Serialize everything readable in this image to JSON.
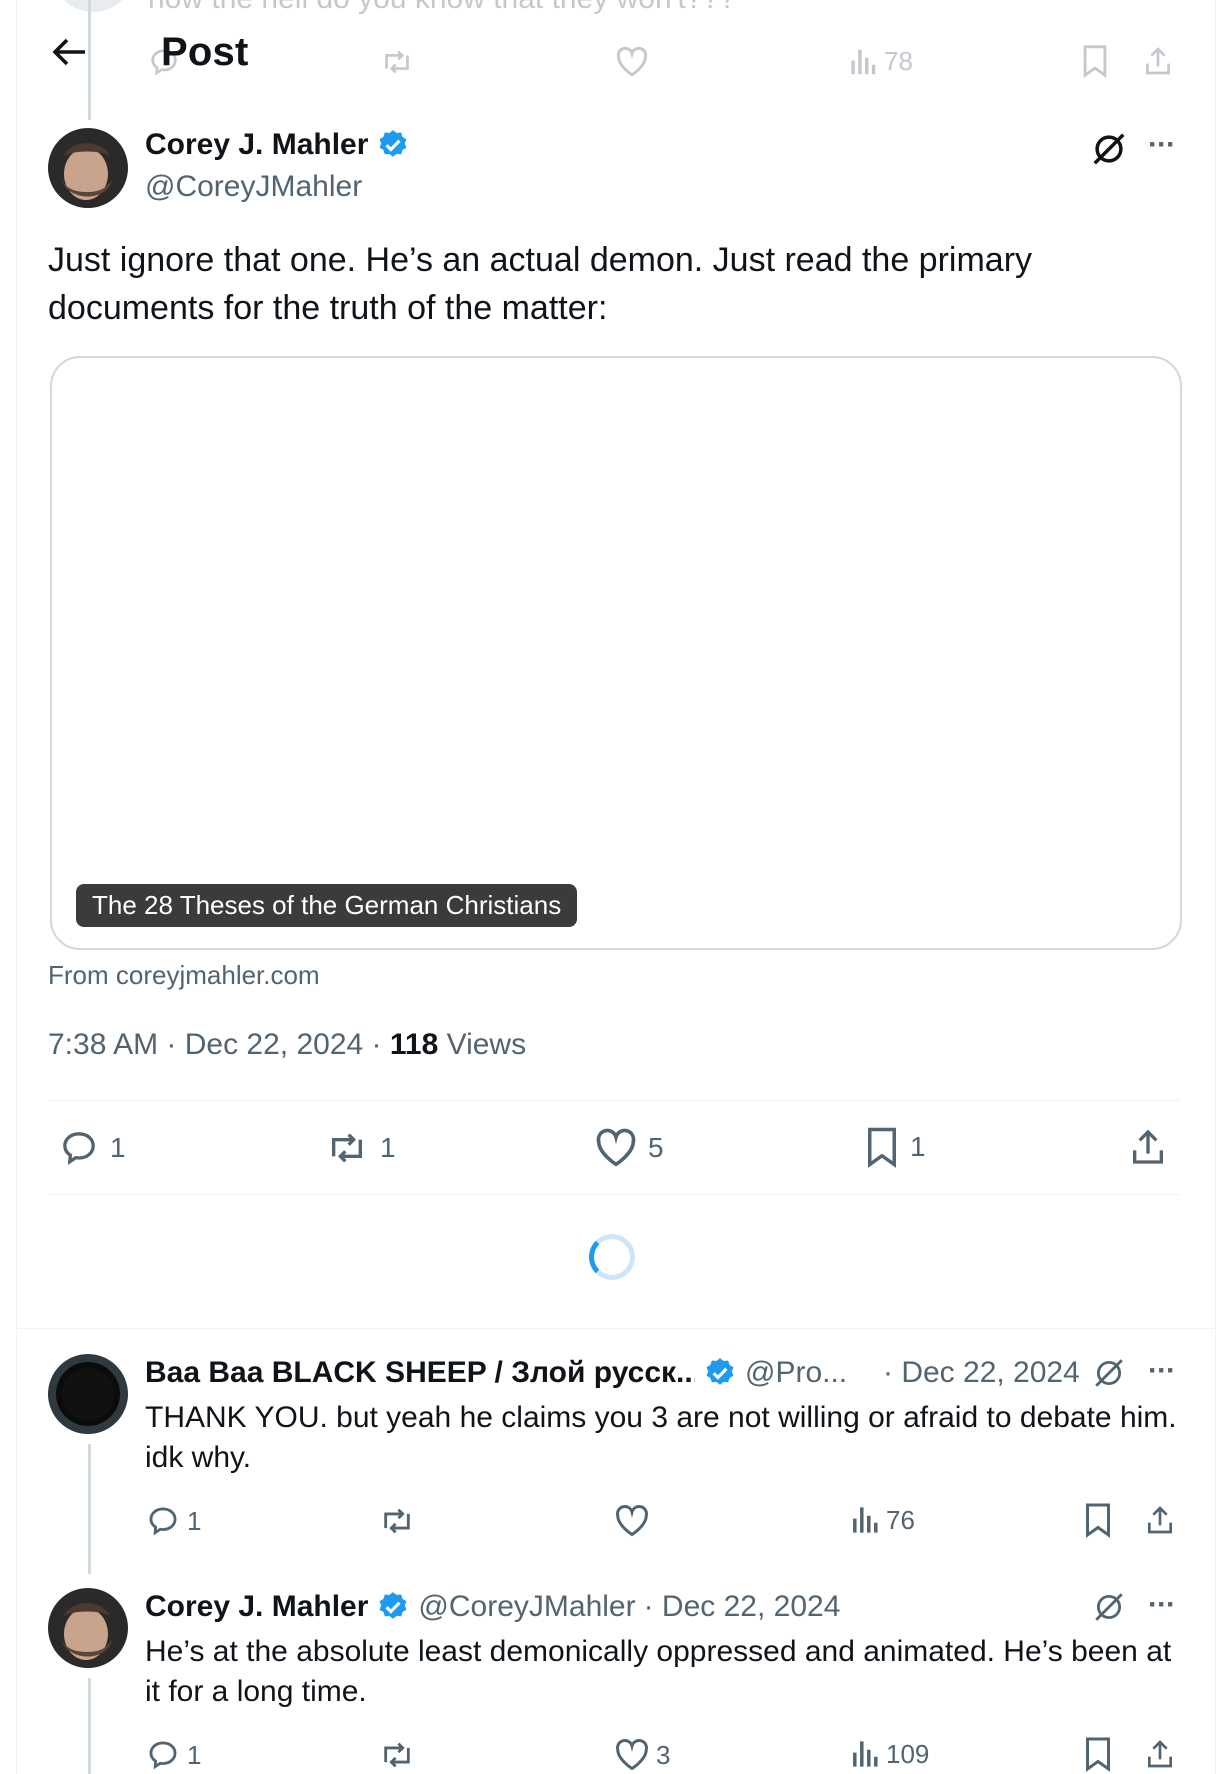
{
  "header": {
    "title": "Post",
    "ghost_text": "how the hell do you know that they won't???",
    "ghost_views": "78"
  },
  "main_post": {
    "author_name": "Corey J. Mahler",
    "author_handle": "@CoreyJMahler",
    "text": "Just ignore that one. He’s an actual demon. Just read the primary documents for the truth of the matter:",
    "card_title": "The 28 Theses of the German Christians",
    "card_source": "From coreyjmahler.com",
    "time": "7:38 AM · Dec 22, 2024 · ",
    "views_count": "118",
    "views_label": " Views",
    "stats": {
      "replies": "1",
      "reposts": "1",
      "likes": "5",
      "bookmarks": "1"
    }
  },
  "replies": [
    {
      "author_name": "Baa Baa BLACK SHEEP / Злой русск...",
      "author_handle": "@Pro...",
      "date": "· Dec 22, 2024",
      "text": "THANK YOU.   but yeah he claims you 3 are not willing or afraid to debate him.   idk why.",
      "replies": "1",
      "reposts": "",
      "likes": "",
      "views": "76"
    },
    {
      "author_name": "Corey J. Mahler",
      "author_handle": "@CoreyJMahler",
      "date": "· Dec 22, 2024",
      "text": "He’s at the absolute least demonically oppressed and animated. He’s been at it for a long time.",
      "replies": "1",
      "reposts": "",
      "likes": "3",
      "views": "109"
    }
  ],
  "colors": {
    "accent": "#1d9bf0",
    "muted": "#536471",
    "text": "#0f1419",
    "border": "#eff3f4"
  },
  "icons": [
    "back-arrow-icon",
    "verified-badge-icon",
    "grok-icon",
    "more-icon",
    "reply-icon",
    "repost-icon",
    "like-icon",
    "bookmark-icon",
    "share-icon",
    "views-icon",
    "loading-spinner"
  ]
}
